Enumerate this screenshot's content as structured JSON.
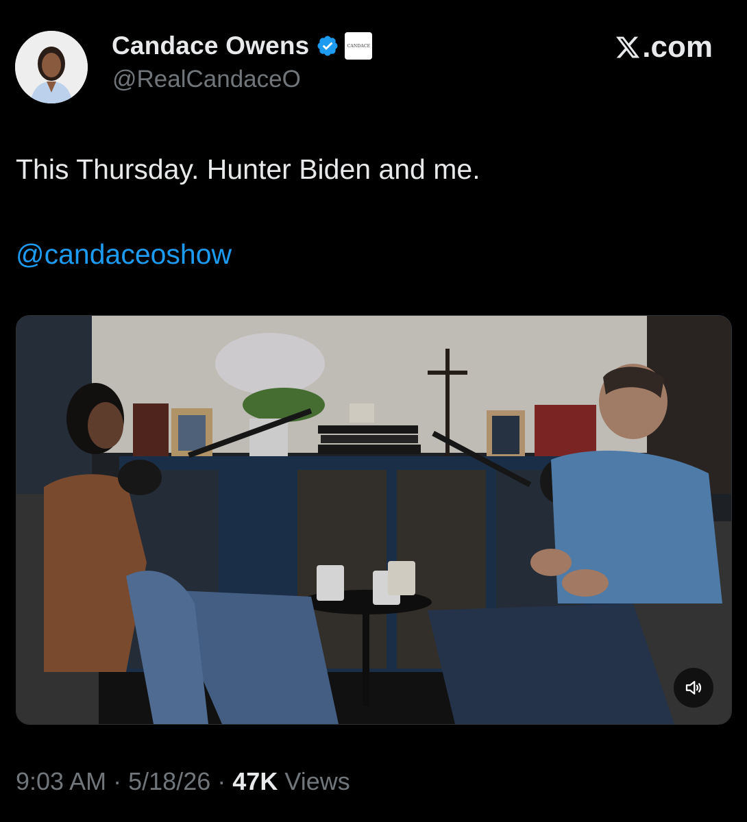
{
  "author": {
    "display_name": "Candace Owens",
    "handle": "@RealCandaceO",
    "affiliate_badge_text": "CANDACE",
    "verified_color": "#1d9bf0"
  },
  "site": {
    "domain_suffix": ".com"
  },
  "tweet": {
    "text": "This Thursday. Hunter Biden and me.",
    "mention": "@candaceoshow"
  },
  "meta": {
    "time": "9:03 AM",
    "separator": "·",
    "date": "5/18/26",
    "views_count": "47K",
    "views_label": "Views"
  },
  "colors": {
    "background": "#000000",
    "primary_text": "#e7e9ea",
    "secondary_text": "#71767b",
    "link": "#1d9bf0"
  },
  "icons": {
    "verified": "verified-badge-icon",
    "mute": "speaker-muted-icon",
    "logo": "x-logo-icon"
  }
}
